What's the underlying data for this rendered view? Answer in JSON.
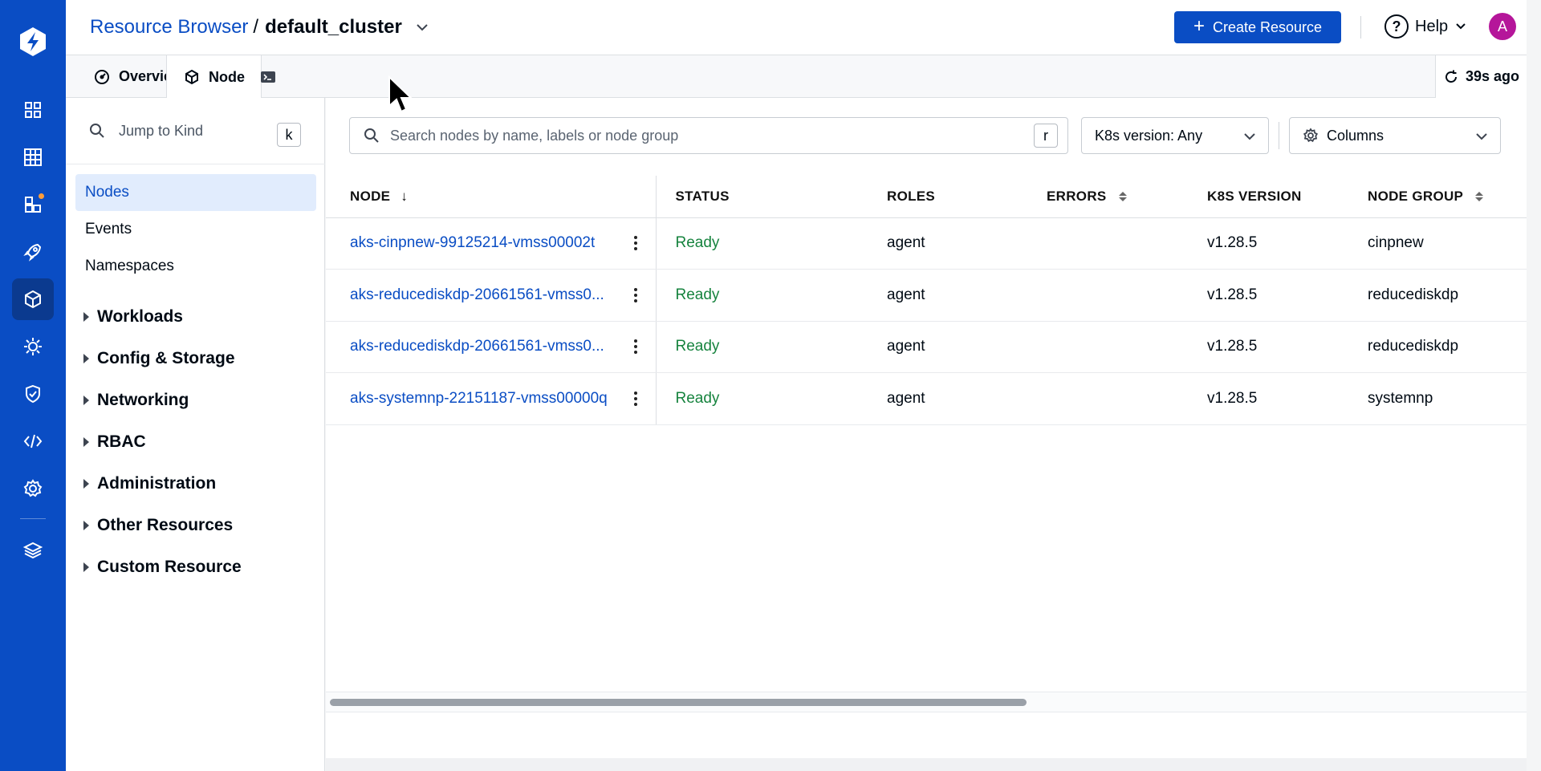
{
  "breadcrumb": {
    "root": "Resource Browser",
    "separator": "/",
    "current": "default_cluster"
  },
  "header": {
    "create_label": "Create Resource",
    "help_label": "Help",
    "avatar_initial": "A"
  },
  "tabs": {
    "overview": "Overview",
    "node": "Node"
  },
  "refresh": {
    "label": "39s ago"
  },
  "sidebar": {
    "jump_placeholder": "Jump to Kind",
    "jump_key": "k",
    "flat_items": [
      "Nodes",
      "Events",
      "Namespaces"
    ],
    "groups": [
      "Workloads",
      "Config & Storage",
      "Networking",
      "RBAC",
      "Administration",
      "Other Resources",
      "Custom Resource"
    ]
  },
  "search": {
    "placeholder": "Search nodes by name, labels or node group",
    "shortcut": "r"
  },
  "filters": {
    "k8s_version": "K8s version: Any",
    "columns": "Columns"
  },
  "table": {
    "headers": {
      "node": "NODE",
      "status": "STATUS",
      "roles": "ROLES",
      "errors": "ERRORS",
      "k8s": "K8S VERSION",
      "group": "NODE GROUP"
    },
    "rows": [
      {
        "node": "aks-cinpnew-99125214-vmss00002t",
        "status": "Ready",
        "roles": "agent",
        "errors": "",
        "k8s": "v1.28.5",
        "group": "cinpnew"
      },
      {
        "node": "aks-reducediskdp-20661561-vmss0...",
        "status": "Ready",
        "roles": "agent",
        "errors": "",
        "k8s": "v1.28.5",
        "group": "reducediskdp"
      },
      {
        "node": "aks-reducediskdp-20661561-vmss0...",
        "status": "Ready",
        "roles": "agent",
        "errors": "",
        "k8s": "v1.28.5",
        "group": "reducediskdp"
      },
      {
        "node": "aks-systemnp-22151187-vmss00000q",
        "status": "Ready",
        "roles": "agent",
        "errors": "",
        "k8s": "v1.28.5",
        "group": "systemnp"
      }
    ]
  },
  "colors": {
    "brand": "#0a4dc4",
    "ready": "#16833e",
    "notification": "#ff9d3a",
    "avatar": "#b5169a"
  }
}
